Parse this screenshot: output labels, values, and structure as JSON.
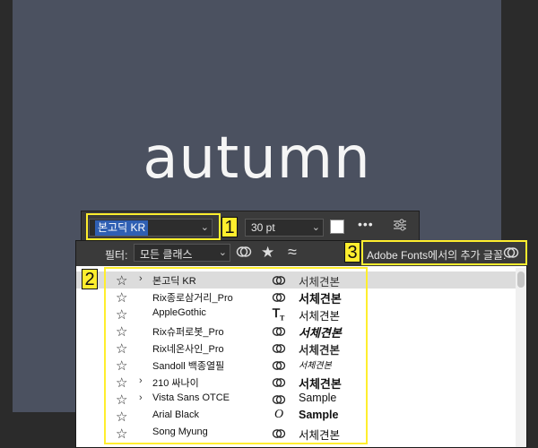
{
  "canvas": {
    "text": "autumn"
  },
  "toolbar": {
    "font_name": "본고딕 KR",
    "font_size": "30 pt",
    "more": "•••"
  },
  "font_panel": {
    "filter_label": "필터:",
    "class_filter": "모든 클래스",
    "adobe_fonts_label": "Adobe Fonts에서의 추가 글꼴:",
    "fonts": [
      {
        "name": "본고딕 KR",
        "sample": "서체견본",
        "expandable": true,
        "selected": true,
        "type_icon": "cloud"
      },
      {
        "name": "Rix종로삼거리_Pro",
        "sample": "서체견본",
        "expandable": false,
        "type_icon": "cloud"
      },
      {
        "name": "AppleGothic",
        "sample": "서체견본",
        "expandable": false,
        "type_icon": "truetype"
      },
      {
        "name": "Rix슈퍼로봇_Pro",
        "sample": "서체견본",
        "expandable": false,
        "type_icon": "cloud"
      },
      {
        "name": "Rix네온사인_Pro",
        "sample": "서체견본",
        "expandable": false,
        "type_icon": "cloud"
      },
      {
        "name": "Sandoll 백종열필",
        "sample": "서체견본",
        "expandable": false,
        "type_icon": "cloud"
      },
      {
        "name": "210 싸나이",
        "sample": "서체견본",
        "expandable": true,
        "type_icon": "cloud"
      },
      {
        "name": "Vista Sans OTCE",
        "sample": "Sample",
        "expandable": true,
        "type_icon": "cloud"
      },
      {
        "name": "Arial Black",
        "sample": "Sample",
        "expandable": false,
        "type_icon": "opentype"
      },
      {
        "name": "Song Myung",
        "sample": "서체견본",
        "expandable": false,
        "type_icon": "cloud"
      }
    ]
  },
  "annotations": [
    "1",
    "2",
    "3"
  ],
  "colors": {
    "canvas": "#4b5160",
    "selection": "#2f5fb3",
    "annotation": "#ffee2e"
  }
}
